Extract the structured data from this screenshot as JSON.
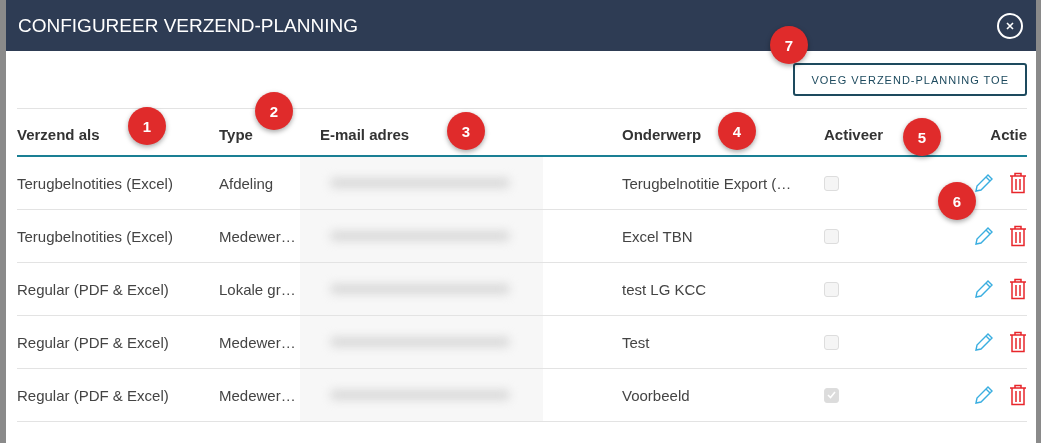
{
  "dialog": {
    "title": "CONFIGUREER VERZEND-PLANNING",
    "add_button": "VOEG VERZEND-PLANNING TOE"
  },
  "table": {
    "columns": [
      "Verzend als",
      "Type",
      "E-mail adres",
      "Onderwerp",
      "Activeer",
      "Actie"
    ],
    "rows": [
      {
        "send_as": "Terugbelnotities (Excel)",
        "type": "Afdeling",
        "subject": "Terugbelnotitie Export (…",
        "active": false
      },
      {
        "send_as": "Terugbelnotities (Excel)",
        "type": "Medewer…",
        "subject": "Excel TBN",
        "active": false
      },
      {
        "send_as": "Regular (PDF & Excel)",
        "type": "Lokale gr…",
        "subject": "test LG KCC",
        "active": false
      },
      {
        "send_as": "Regular (PDF & Excel)",
        "type": "Medewer…",
        "subject": "Test",
        "active": false
      },
      {
        "send_as": "Regular (PDF & Excel)",
        "type": "Medewer…",
        "subject": "Voorbeeld",
        "active": true
      }
    ]
  },
  "annotations": [
    "1",
    "2",
    "3",
    "4",
    "5",
    "6",
    "7"
  ]
}
